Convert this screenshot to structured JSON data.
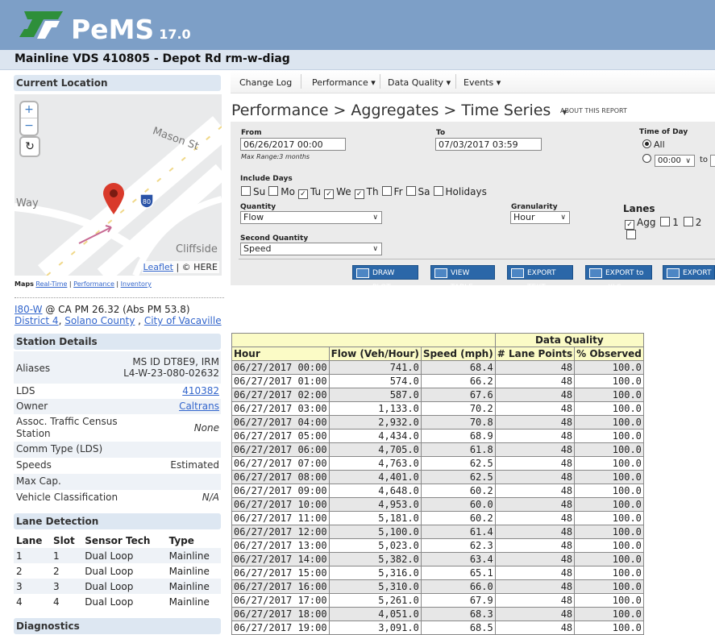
{
  "app": {
    "name": "PeMS",
    "version": "17.0"
  },
  "page_title": "Mainline VDS 410805 - Depot Rd rm-w-diag",
  "sidebar": {
    "current_location_title": "Current Location",
    "map": {
      "street_label_1": "Mason St",
      "street_label_2": "Way",
      "place_label": "Cliffside",
      "highway_shield": "80",
      "attribution_link": "Leaflet",
      "attribution_text": "| © HERE",
      "zoom_in": "+",
      "zoom_out": "−",
      "reset": "↻"
    },
    "maps_label": "Maps",
    "maps_links": [
      "Real-Time",
      "Performance",
      "Inventory"
    ],
    "location": {
      "freeway_link": "I80-W",
      "pm_text": "@ CA PM 26.32 (Abs PM 53.8)",
      "district_link": "District 4",
      "county_link": "Solano County",
      "city_link": "City of Vacaville"
    },
    "station_details_title": "Station Details",
    "station_details": {
      "aliases_label": "Aliases",
      "aliases_value_1": "MS ID DT8E9, IRM",
      "aliases_value_2": "L4-W-23-080-02632",
      "lds_label": "LDS",
      "lds_value": "410382",
      "owner_label": "Owner",
      "owner_value": "Caltrans",
      "assoc_label_1": "Assoc. Traffic Census",
      "assoc_label_2": "Station",
      "assoc_value": "None",
      "comm_label": "Comm Type (LDS)",
      "speeds_label": "Speeds",
      "speeds_value": "Estimated",
      "maxcap_label": "Max Cap.",
      "vclass_label": "Vehicle Classification",
      "vclass_value": "N/A"
    },
    "lane_detection_title": "Lane Detection",
    "lane_headers": [
      "Lane",
      "Slot",
      "Sensor Tech",
      "Type"
    ],
    "lanes": [
      [
        "1",
        "1",
        "Dual Loop",
        "Mainline"
      ],
      [
        "2",
        "2",
        "Dual Loop",
        "Mainline"
      ],
      [
        "3",
        "3",
        "Dual Loop",
        "Mainline"
      ],
      [
        "4",
        "4",
        "Dual Loop",
        "Mainline"
      ]
    ],
    "diagnostics_title": "Diagnostics"
  },
  "nav": {
    "change_log": "Change Log",
    "performance": "Performance ▾",
    "data_quality": "Data Quality ▾",
    "events": "Events ▾"
  },
  "breadcrumb": "Performance > Aggregates > Time Series",
  "breadcrumb_caret": "▾",
  "about_report": "ABOUT THIS REPORT",
  "form": {
    "from_label": "From",
    "from_value": "06/26/2017 00:00",
    "max_range": "Max Range:3 months",
    "to_label": "To",
    "to_value": "07/03/2017 03:59",
    "time_of_day_label": "Time of Day",
    "all_label": "All",
    "tod_from": "00:00",
    "tod_to_label": "to",
    "include_days_label": "Include Days",
    "days": [
      {
        "label": "Su",
        "checked": false
      },
      {
        "label": "Mo",
        "checked": false
      },
      {
        "label": "Tu",
        "checked": true
      },
      {
        "label": "We",
        "checked": true
      },
      {
        "label": "Th",
        "checked": true
      },
      {
        "label": "Fr",
        "checked": false
      },
      {
        "label": "Sa",
        "checked": false
      },
      {
        "label": "Holidays",
        "checked": false
      }
    ],
    "quantity_label": "Quantity",
    "quantity_value": "Flow",
    "granularity_label": "Granularity",
    "granularity_value": "Hour",
    "lanes_label": "Lanes",
    "lane_agg": "Agg",
    "lane_1": "1",
    "lane_2": "2",
    "second_quantity_label": "Second Quantity",
    "second_quantity_value": "Speed",
    "buttons": [
      "DRAW PLOT",
      "VIEW TABLE",
      "EXPORT TEXT",
      "EXPORT to .XLS",
      "EXPORT to"
    ]
  },
  "table": {
    "group_header": "Data Quality",
    "headers": [
      "Hour",
      "Flow (Veh/Hour)",
      "Speed (mph)",
      "# Lane Points",
      "% Observed"
    ],
    "rows": [
      [
        "06/27/2017 00:00",
        "741.0",
        "68.4",
        "48",
        "100.0"
      ],
      [
        "06/27/2017 01:00",
        "574.0",
        "66.2",
        "48",
        "100.0"
      ],
      [
        "06/27/2017 02:00",
        "587.0",
        "67.6",
        "48",
        "100.0"
      ],
      [
        "06/27/2017 03:00",
        "1,133.0",
        "70.2",
        "48",
        "100.0"
      ],
      [
        "06/27/2017 04:00",
        "2,932.0",
        "70.8",
        "48",
        "100.0"
      ],
      [
        "06/27/2017 05:00",
        "4,434.0",
        "68.9",
        "48",
        "100.0"
      ],
      [
        "06/27/2017 06:00",
        "4,705.0",
        "61.8",
        "48",
        "100.0"
      ],
      [
        "06/27/2017 07:00",
        "4,763.0",
        "62.5",
        "48",
        "100.0"
      ],
      [
        "06/27/2017 08:00",
        "4,401.0",
        "62.5",
        "48",
        "100.0"
      ],
      [
        "06/27/2017 09:00",
        "4,648.0",
        "60.2",
        "48",
        "100.0"
      ],
      [
        "06/27/2017 10:00",
        "4,953.0",
        "60.0",
        "48",
        "100.0"
      ],
      [
        "06/27/2017 11:00",
        "5,181.0",
        "60.2",
        "48",
        "100.0"
      ],
      [
        "06/27/2017 12:00",
        "5,100.0",
        "61.4",
        "48",
        "100.0"
      ],
      [
        "06/27/2017 13:00",
        "5,023.0",
        "62.3",
        "48",
        "100.0"
      ],
      [
        "06/27/2017 14:00",
        "5,382.0",
        "63.4",
        "48",
        "100.0"
      ],
      [
        "06/27/2017 15:00",
        "5,316.0",
        "65.1",
        "48",
        "100.0"
      ],
      [
        "06/27/2017 16:00",
        "5,310.0",
        "66.0",
        "48",
        "100.0"
      ],
      [
        "06/27/2017 17:00",
        "5,261.0",
        "67.9",
        "48",
        "100.0"
      ],
      [
        "06/27/2017 18:00",
        "4,051.0",
        "68.3",
        "48",
        "100.0"
      ],
      [
        "06/27/2017 19:00",
        "3,091.0",
        "68.5",
        "48",
        "100.0"
      ]
    ]
  },
  "colors": {
    "header_bg": "#7d9fc7",
    "accent_blue": "#2b67a8",
    "table_header": "#fbfbc6",
    "marker_red": "#d93a2b"
  }
}
